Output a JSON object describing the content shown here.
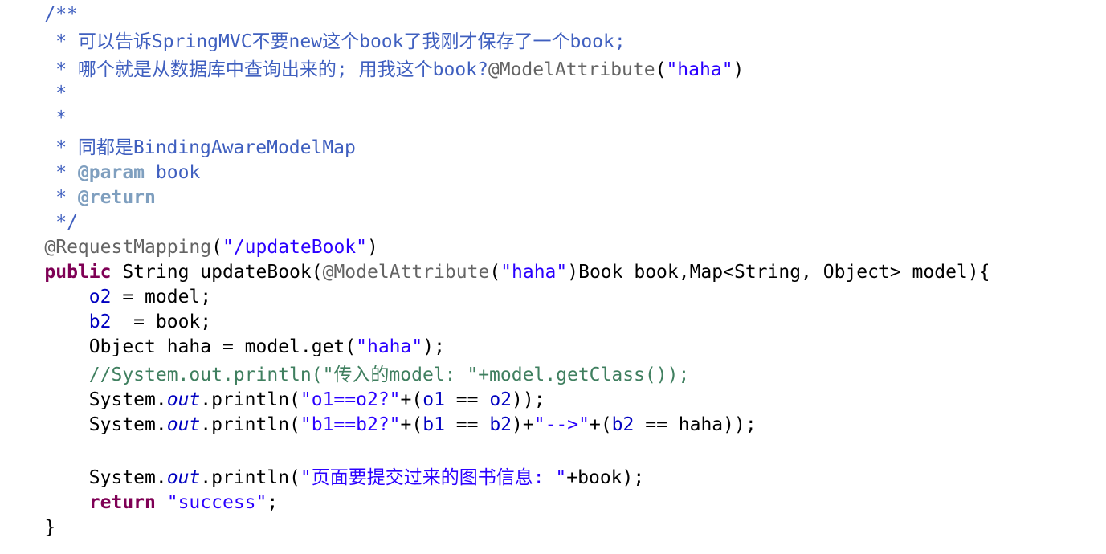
{
  "colors": {
    "background": "#ffffff",
    "javadoc": "#3f5fbf",
    "javadoc_tag": "#7f9fbf",
    "line_comment": "#3f7f5f",
    "keyword": "#7f0055",
    "string": "#2a00ff",
    "field": "#0000c0",
    "annotation": "#646464",
    "plain": "#000000"
  },
  "code": {
    "l1": {
      "doc": "/**"
    },
    "l2": {
      "doc": " * 可以告诉SpringMVC不要new这个book了我刚才保存了一个book;"
    },
    "l3": {
      "doc": " * 哪个就是从数据库中查询出来的; 用我这个book?",
      "annot": "@ModelAttribute",
      "p1": "(",
      "str": "\"haha\"",
      "p2": ")"
    },
    "l4": {
      "doc": " *"
    },
    "l5": {
      "doc": " *"
    },
    "l6": {
      "doc": " * 同都是BindingAwareModelMap"
    },
    "l7": {
      "doc": " * ",
      "tag": "@param",
      "rest": " book"
    },
    "l8": {
      "doc": " * ",
      "tag": "@return"
    },
    "l9": {
      "doc": " */"
    },
    "l10": {
      "annot": "@RequestMapping",
      "p1": "(",
      "str": "\"/updateBook\"",
      "p2": ")"
    },
    "l11": {
      "kw": "public",
      "a": " String updateBook(",
      "annot": "@ModelAttribute",
      "p1": "(",
      "str": "\"haha\"",
      "b": ")Book book,Map<String, Object> model){"
    },
    "l12": {
      "indent": "    ",
      "field": "o2",
      "rest": " = model;"
    },
    "l13": {
      "indent": "    ",
      "field": "b2",
      "rest": "  = book;"
    },
    "l14": {
      "indent": "    ",
      "a": "Object haha = model.get(",
      "str": "\"haha\"",
      "b": ");"
    },
    "l15": {
      "indent": "    ",
      "comment": "//System.out.println(\"传入的model: \"+model.getClass());"
    },
    "l16": {
      "indent": "    ",
      "a": "System.",
      "static": "out",
      "b": ".println(",
      "str": "\"o1==o2?\"",
      "c": "+(",
      "f1": "o1",
      "d": " == ",
      "f2": "o2",
      "e": "));"
    },
    "l17": {
      "indent": "    ",
      "a": "System.",
      "static": "out",
      "b": ".println(",
      "str1": "\"b1==b2?\"",
      "c": "+(",
      "f1": "b1",
      "d": " == ",
      "f2": "b2",
      "e": ")+",
      "str2": "\"-->\"",
      "f": "+(",
      "f3": "b2",
      "g": " == haha));"
    },
    "l18": {
      "indent": "    ",
      "a": "System.",
      "static": "out",
      "b": ".println(",
      "str": "\"页面要提交过来的图书信息: \"",
      "c": "+book);"
    },
    "l19": {
      "indent": "    ",
      "kw": "return",
      "sp": " ",
      "str": "\"success\"",
      "b": ";"
    },
    "l20": {
      "a": "}"
    }
  }
}
